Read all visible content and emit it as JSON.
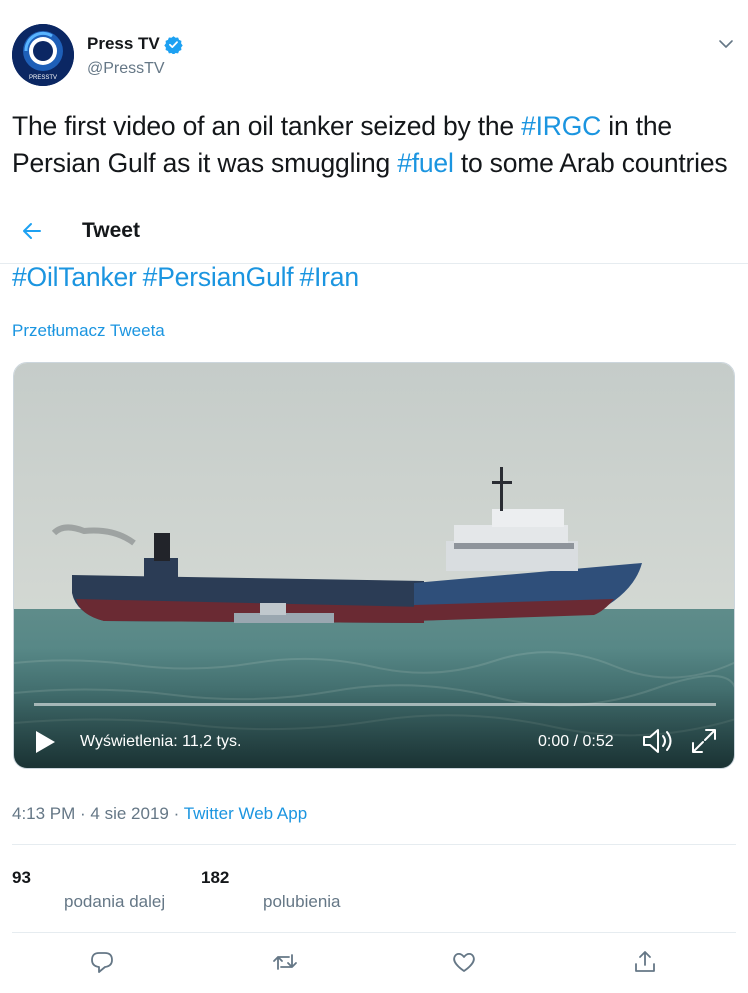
{
  "author": {
    "display_name": "Press TV",
    "handle": "@PressTV",
    "avatar_text": "PRESSTV",
    "verified_icon": "verified-badge-icon"
  },
  "tweet": {
    "text_part1": "The first video of an oil tanker seized by the ",
    "tag_irgc": "#IRGC",
    "text_part2": " in the Persian Gulf as it was smuggling ",
    "tag_fuel": "#fuel",
    "text_part3": " to some Arab countries",
    "hashtags": [
      "#OilTanker",
      "#PersianGulf",
      "#Iran"
    ],
    "translate_link": "Przetłumacz Tweeta"
  },
  "header": {
    "title": "Tweet",
    "back_icon": "arrow-left-icon"
  },
  "video": {
    "views": "Wyświetlenia: 11,2 tys.",
    "duration": "0:00 / 0:52",
    "progress_fraction": 0
  },
  "meta": {
    "time": "4:13 PM",
    "sep1": " · ",
    "date": "4 sie 2019",
    "sep2": " · ",
    "source": "Twitter Web App"
  },
  "stats": {
    "retweets_count": "93",
    "retweets_label": "podania dalej",
    "likes_count": "182",
    "likes_label": "polubienia"
  },
  "actions": [
    "reply-icon",
    "retweet-icon",
    "like-icon",
    "share-icon"
  ],
  "colors": {
    "link": "#1b95e0",
    "secondary_text": "#657786",
    "primary_text": "#14171a",
    "divider": "#e6ecf0"
  }
}
